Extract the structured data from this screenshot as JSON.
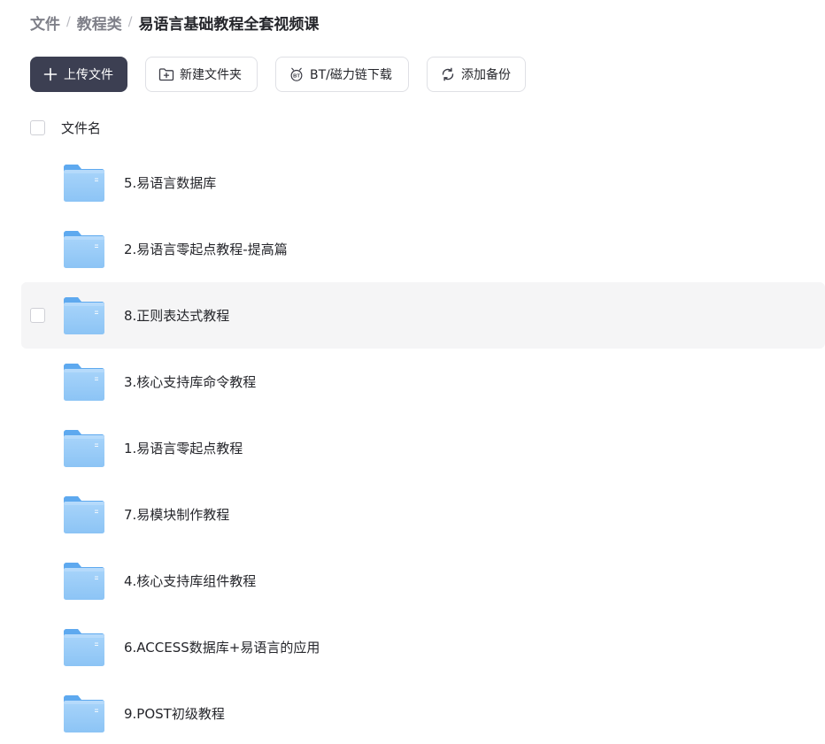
{
  "breadcrumb": {
    "items": [
      "文件",
      "教程类"
    ],
    "separator": "/",
    "current": "易语言基础教程全套视频课"
  },
  "toolbar": {
    "upload_label": "上传文件",
    "new_folder_label": "新建文件夹",
    "bt_label": "BT/磁力链下载",
    "backup_label": "添加备份",
    "upload_icon": "plus-icon",
    "new_folder_icon": "folder-plus-icon",
    "bt_icon": "bt-icon",
    "backup_icon": "refresh-icon"
  },
  "list": {
    "header_label": "文件名",
    "items": [
      {
        "name": "5.易语言数据库"
      },
      {
        "name": "2.易语言零起点教程-提高篇"
      },
      {
        "name": "8.正则表达式教程"
      },
      {
        "name": "3.核心支持库命令教程"
      },
      {
        "name": "1.易语言零起点教程"
      },
      {
        "name": "7.易模块制作教程"
      },
      {
        "name": "4.核心支持库组件教程"
      },
      {
        "name": "6.ACCESS数据库+易语言的应用"
      },
      {
        "name": "9.POST初级教程"
      }
    ]
  },
  "colors": {
    "primary_button": "#3c3f52",
    "folder_body": "#8cc4f5",
    "folder_tab": "#5ea9ef",
    "row_hover": "#f5f5f6"
  }
}
